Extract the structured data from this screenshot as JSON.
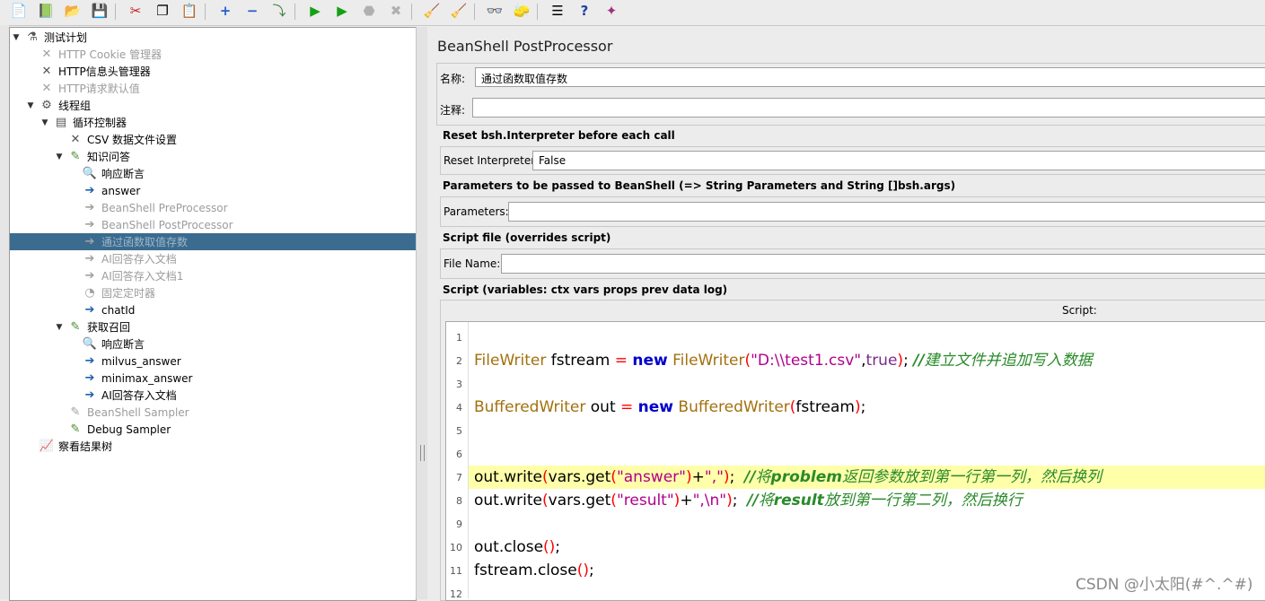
{
  "toolbar": {
    "buttons": [
      "new-icon",
      "templates-icon",
      "open-icon",
      "save-icon",
      "cut-icon",
      "copy-icon",
      "paste-icon",
      "expand-icon",
      "collapse-icon",
      "toggle-icon",
      "start-icon",
      "start-no-pause-icon",
      "stop-icon",
      "shutdown-icon",
      "clear-icon",
      "clear-all-icon",
      "search-icon",
      "reset-search-icon",
      "function-helper-icon",
      "help-icon",
      "remote-icon"
    ]
  },
  "tree": {
    "selected_index": 12,
    "nodes": [
      {
        "label": "测试计划",
        "icon": "test-plan-icon",
        "glyph": "⚗",
        "level": 0,
        "toggle": "▼",
        "disabled": false
      },
      {
        "label": "HTTP Cookie 管理器",
        "icon": "config-element-icon",
        "glyph": "✕",
        "level": 1,
        "toggle": "",
        "disabled": true
      },
      {
        "label": "HTTP信息头管理器",
        "icon": "config-element-icon",
        "glyph": "✕",
        "level": 1,
        "toggle": "",
        "disabled": false
      },
      {
        "label": "HTTP请求默认值",
        "icon": "config-element-icon",
        "glyph": "✕",
        "level": 1,
        "toggle": "",
        "disabled": true
      },
      {
        "label": "线程组",
        "icon": "thread-group-icon",
        "glyph": "⚙",
        "level": 1,
        "toggle": "▼",
        "disabled": false
      },
      {
        "label": "循环控制器",
        "icon": "loop-controller-icon",
        "glyph": "▤",
        "level": 2,
        "toggle": "▼",
        "disabled": false
      },
      {
        "label": "CSV 数据文件设置",
        "icon": "csv-config-icon",
        "glyph": "✕",
        "level": 3,
        "toggle": "",
        "disabled": false
      },
      {
        "label": "知识问答",
        "icon": "sampler-icon",
        "glyph": "✎",
        "level": 3,
        "toggle": "▼",
        "disabled": false
      },
      {
        "label": "响应断言",
        "icon": "assertion-icon",
        "glyph": "🔍",
        "level": 4,
        "toggle": "",
        "disabled": false
      },
      {
        "label": "answer",
        "icon": "post-processor-icon",
        "glyph": "➔",
        "level": 4,
        "toggle": "",
        "disabled": false
      },
      {
        "label": "BeanShell PreProcessor",
        "icon": "pre-processor-icon",
        "glyph": "➔",
        "level": 4,
        "toggle": "",
        "disabled": true
      },
      {
        "label": "BeanShell PostProcessor",
        "icon": "post-processor-icon",
        "glyph": "➔",
        "level": 4,
        "toggle": "",
        "disabled": true
      },
      {
        "label": "通过函数取值存数",
        "icon": "post-processor-icon",
        "glyph": "➔",
        "level": 4,
        "toggle": "",
        "disabled": true
      },
      {
        "label": "AI回答存入文档",
        "icon": "post-processor-icon",
        "glyph": "➔",
        "level": 4,
        "toggle": "",
        "disabled": true
      },
      {
        "label": "AI回答存入文档1",
        "icon": "post-processor-icon",
        "glyph": "➔",
        "level": 4,
        "toggle": "",
        "disabled": true
      },
      {
        "label": "固定定时器",
        "icon": "timer-icon",
        "glyph": "◔",
        "level": 4,
        "toggle": "",
        "disabled": true
      },
      {
        "label": "chatId",
        "icon": "post-processor-icon",
        "glyph": "➔",
        "level": 4,
        "toggle": "",
        "disabled": false
      },
      {
        "label": "获取召回",
        "icon": "sampler-icon",
        "glyph": "✎",
        "level": 3,
        "toggle": "▼",
        "disabled": false
      },
      {
        "label": "响应断言",
        "icon": "assertion-icon",
        "glyph": "🔍",
        "level": 4,
        "toggle": "",
        "disabled": false
      },
      {
        "label": "milvus_answer",
        "icon": "post-processor-icon",
        "glyph": "➔",
        "level": 4,
        "toggle": "",
        "disabled": false
      },
      {
        "label": "minimax_answer",
        "icon": "post-processor-icon",
        "glyph": "➔",
        "level": 4,
        "toggle": "",
        "disabled": false
      },
      {
        "label": "AI回答存入文档",
        "icon": "post-processor-icon",
        "glyph": "➔",
        "level": 4,
        "toggle": "",
        "disabled": false
      },
      {
        "label": "BeanShell Sampler",
        "icon": "sampler-icon",
        "glyph": "✎",
        "level": 3,
        "toggle": "",
        "disabled": true
      },
      {
        "label": "Debug Sampler",
        "icon": "sampler-icon",
        "glyph": "✎",
        "level": 3,
        "toggle": "",
        "disabled": false
      },
      {
        "label": "察看结果树",
        "icon": "listener-icon",
        "glyph": "📈",
        "level": 1,
        "toggle": "",
        "disabled": false
      }
    ]
  },
  "panel": {
    "title": "BeanShell PostProcessor",
    "name_label": "名称:",
    "name_value": "通过函数取值存数",
    "comment_label": "注释:",
    "comment_value": "",
    "reset_section": "Reset bsh.Interpreter before each call",
    "reset_label": "Reset Interpreter:",
    "reset_value": "False",
    "params_section": "Parameters to be passed to BeanShell (=> String Parameters and String []bsh.args)",
    "params_label": "Parameters:",
    "params_value": "",
    "file_section": "Script file (overrides script)",
    "file_label": "File Name:",
    "file_value": "",
    "script_section": "Script (variables: ctx vars props prev data log)",
    "script_label": "Script:"
  },
  "script": {
    "highlight_line": 7,
    "line_numbers": [
      "1",
      "2",
      "3",
      "4",
      "5",
      "6",
      "7",
      "8",
      "9",
      "10",
      "11",
      "12"
    ],
    "lines": [
      [],
      [
        [
          "cls",
          "FileWriter"
        ],
        [
          "",
          " fstream "
        ],
        [
          "op",
          "="
        ],
        [
          "",
          " "
        ],
        [
          "kw",
          "new"
        ],
        [
          "",
          " "
        ],
        [
          "cls",
          "FileWriter"
        ],
        [
          "op",
          "("
        ],
        [
          "str",
          "\"D:\\\\test1.csv\""
        ],
        [
          "",
          ","
        ],
        [
          "tv",
          "true"
        ],
        [
          "op",
          ")"
        ],
        [
          "",
          "; "
        ],
        [
          "cmb",
          "//"
        ],
        [
          "cm",
          "建立文件并追加写入数据"
        ]
      ],
      [],
      [
        [
          "cls",
          "BufferedWriter"
        ],
        [
          "",
          " out "
        ],
        [
          "op",
          "="
        ],
        [
          "",
          " "
        ],
        [
          "kw",
          "new"
        ],
        [
          "",
          " "
        ],
        [
          "cls",
          "BufferedWriter"
        ],
        [
          "op",
          "("
        ],
        [
          "",
          "fstream"
        ],
        [
          "op",
          ")"
        ],
        [
          "",
          ";"
        ]
      ],
      [],
      [],
      [
        [
          "",
          "out.write"
        ],
        [
          "op",
          "("
        ],
        [
          "",
          "vars.get"
        ],
        [
          "op",
          "("
        ],
        [
          "str",
          "\"answer\""
        ],
        [
          "op",
          ")"
        ],
        [
          "",
          "+"
        ],
        [
          "str",
          "\",\""
        ],
        [
          "op",
          ")"
        ],
        [
          "",
          ";  "
        ],
        [
          "cmb",
          "//"
        ],
        [
          "cm",
          "将"
        ],
        [
          "cmb",
          "problem"
        ],
        [
          "cm",
          "返回参数放到第一行第一列，然后换列"
        ]
      ],
      [
        [
          "",
          "out.write"
        ],
        [
          "op",
          "("
        ],
        [
          "",
          "vars.get"
        ],
        [
          "op",
          "("
        ],
        [
          "str",
          "\"result\""
        ],
        [
          "op",
          ")"
        ],
        [
          "",
          "+"
        ],
        [
          "str",
          "\",\\n\""
        ],
        [
          "op",
          ")"
        ],
        [
          "",
          ";  "
        ],
        [
          "cmb",
          "//"
        ],
        [
          "cm",
          "将"
        ],
        [
          "cmb",
          "result"
        ],
        [
          "cm",
          "放到第一行第二列，然后换行"
        ]
      ],
      [],
      [
        [
          "",
          "out.close"
        ],
        [
          "op",
          "()"
        ],
        [
          "",
          ";"
        ]
      ],
      [
        [
          "",
          "fstream.close"
        ],
        [
          "op",
          "()"
        ],
        [
          "",
          ";"
        ]
      ],
      []
    ]
  },
  "watermark": "CSDN @小太阳(#^.^#)"
}
